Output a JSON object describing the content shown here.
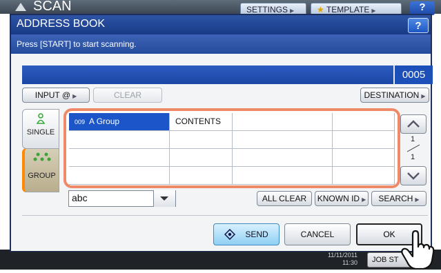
{
  "app": {
    "title": "SCAN",
    "settings_label": "SETTINGS",
    "template_label": "TEMPLATE",
    "help_label": "?",
    "date": "11/11/2011",
    "time": "11:30",
    "job_status_label": "JOB ST"
  },
  "dialog": {
    "title": "ADDRESS BOOK",
    "help_label": "?",
    "message": "Press [START] to start scanning.",
    "destination_value": "",
    "count": "0005"
  },
  "toolbar": {
    "input_label": "INPUT @",
    "clear_label": "CLEAR",
    "destination_label": "DESTINATION"
  },
  "tabs": {
    "single_label": "SINGLE",
    "group_label": "GROUP"
  },
  "table": {
    "rows": [
      [
        {
          "num": "009",
          "text": "A Group"
        },
        {
          "num": "",
          "text": "CONTENTS"
        },
        {
          "num": "",
          "text": ""
        },
        {
          "num": "",
          "text": ""
        }
      ],
      [
        {
          "num": "",
          "text": ""
        },
        {
          "num": "",
          "text": ""
        },
        {
          "num": "",
          "text": ""
        },
        {
          "num": "",
          "text": ""
        }
      ],
      [
        {
          "num": "",
          "text": ""
        },
        {
          "num": "",
          "text": ""
        },
        {
          "num": "",
          "text": ""
        },
        {
          "num": "",
          "text": ""
        }
      ],
      [
        {
          "num": "",
          "text": ""
        },
        {
          "num": "",
          "text": ""
        },
        {
          "num": "",
          "text": ""
        },
        {
          "num": "",
          "text": ""
        }
      ]
    ]
  },
  "pagination": {
    "current": "1",
    "total": "1"
  },
  "search_row": {
    "field_value": "abc",
    "all_clear_label": "ALL CLEAR",
    "known_id_label": "KNOWN ID",
    "search_label": "SEARCH"
  },
  "footer": {
    "send_label": "SEND",
    "cancel_label": "CANCEL",
    "ok_label": "OK"
  },
  "colors": {
    "title_bar": "#183a86",
    "selection": "#1c55c8",
    "table_frame": "#ee8a68",
    "group_tab_accent": "#ff8a00",
    "send_button": "#8fcff3"
  }
}
